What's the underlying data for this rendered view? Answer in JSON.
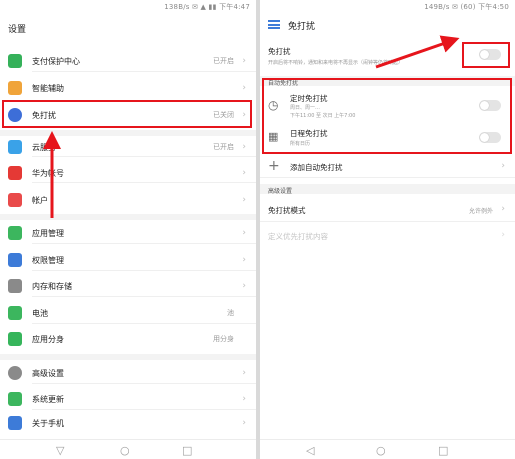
{
  "left": {
    "status": "138B/s ✉ ▲ ▮▮ 下午4:47",
    "title": "设置",
    "items": [
      {
        "label": "支付保护中心",
        "value": "已开启"
      },
      {
        "label": "智能辅助",
        "value": ""
      },
      {
        "label": "免打扰",
        "value": "已关闭"
      },
      {
        "label": "云服务",
        "value": "已开启"
      },
      {
        "label": "华为帐号",
        "value": ""
      },
      {
        "label": "帐户",
        "value": ""
      },
      {
        "label": "应用管理",
        "value": ""
      },
      {
        "label": "权限管理",
        "value": ""
      },
      {
        "label": "内存和存储",
        "value": ""
      },
      {
        "label": "电池",
        "value": "池"
      },
      {
        "label": "应用分身",
        "value": "用分身"
      },
      {
        "label": "高级设置",
        "value": ""
      },
      {
        "label": "系统更新",
        "value": ""
      },
      {
        "label": "关于手机",
        "value": ""
      }
    ],
    "nav": [
      "▽",
      "○",
      "□"
    ]
  },
  "right": {
    "status": "149B/s ✉ (60) 下午4:50",
    "title": "免打扰",
    "dnd": {
      "label": "免打扰",
      "desc": "开启后将不响铃，通知和来电将不再显示（闹钟等仍将响起）"
    },
    "auto_section": "自动免打扰",
    "scheduled": {
      "label": "定时免打扰",
      "sub": "周日、周一…",
      "detail": "下午11:00 至 次日 上午7:00"
    },
    "event": {
      "label": "日程免打扰",
      "sub": "所有日历"
    },
    "add_rule": "添加自动免打扰",
    "advanced_section": "高级设置",
    "mode": {
      "label": "免打扰模式",
      "value": "允许例外"
    },
    "priority": "定义优先打扰内容",
    "nav": [
      "◁",
      "○",
      "□"
    ]
  },
  "colors": {
    "accent": "#3d7bd8",
    "highlight": "#e6151c"
  }
}
